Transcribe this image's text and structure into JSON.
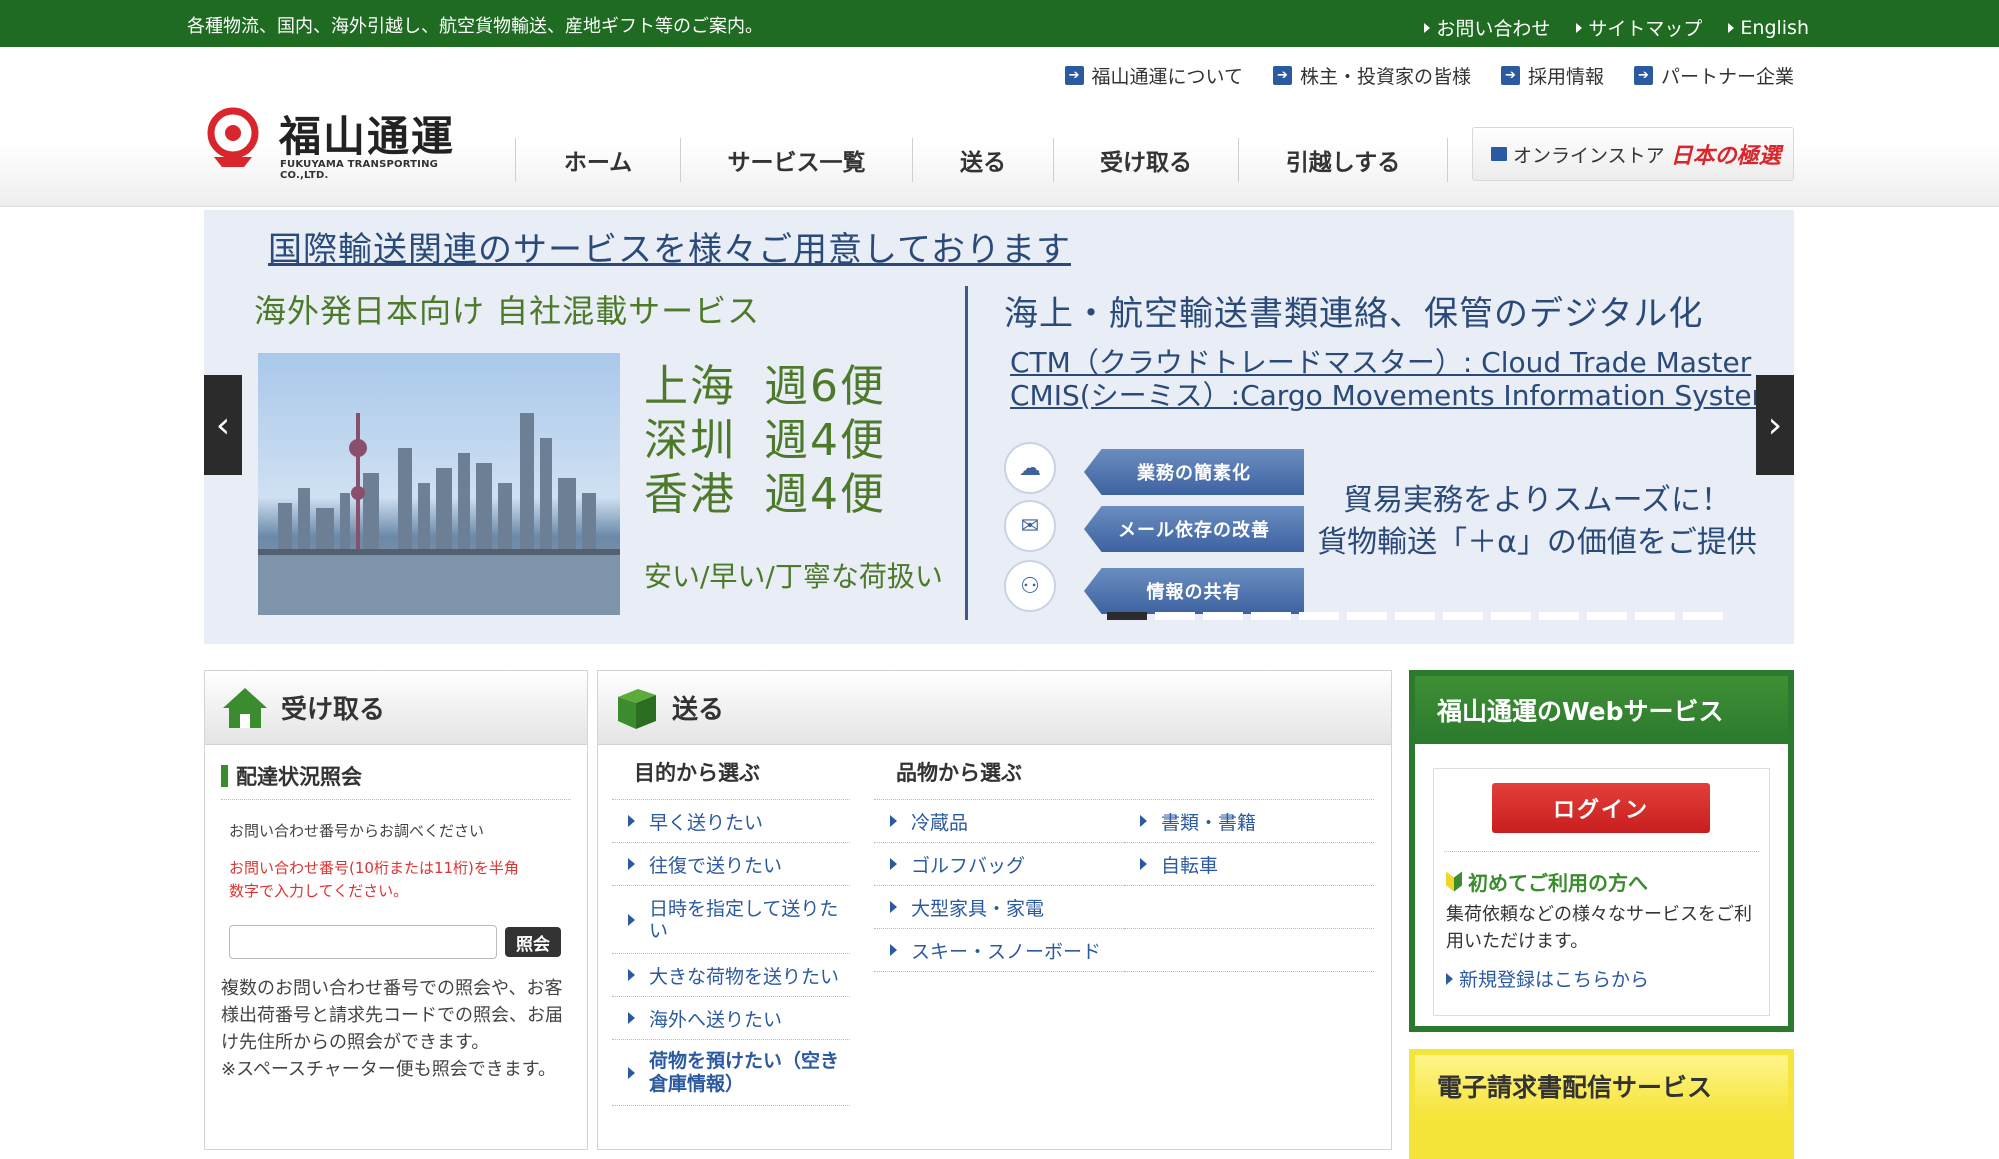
{
  "topbar": {
    "tagline": "各種物流、国内、海外引越し、航空貨物輸送、産地ギフト等のご案内。",
    "links": [
      "お問い合わせ",
      "サイトマップ",
      "English"
    ]
  },
  "subnav": [
    "福山通運について",
    "株主・投資家の皆様",
    "採用情報",
    "パートナー企業"
  ],
  "logo": {
    "name": "福山通運",
    "sub": "FUKUYAMA TRANSPORTING CO.,LTD."
  },
  "gnav": [
    "ホーム",
    "サービス一覧",
    "送る",
    "受け取る",
    "引越しする"
  ],
  "store": {
    "label": "オンラインストア",
    "brand": "日本の極選"
  },
  "banner": {
    "headline": "国際輸送関連のサービスを様々ご用意しております",
    "left_heading": "海外発日本向け 自社混載サービス",
    "routes": [
      {
        "city": "上海",
        "freq": "週6便"
      },
      {
        "city": "深圳",
        "freq": "週4便"
      },
      {
        "city": "香港",
        "freq": "週4便"
      }
    ],
    "slogan": "安い/早い/丁寧な荷扱い",
    "right_heading": "海上・航空輸送書類連絡、保管のデジタル化",
    "ctm": "CTM（クラウドトレードマスター）: Cloud Trade Master",
    "cmis": "CMIS(シーミス）:Cargo Movements Information System",
    "features": [
      "業務の簡素化",
      "メール依存の改善",
      "情報の共有"
    ],
    "right_slogan_1": "貿易実務をよりスムーズに！",
    "right_slogan_2": "貨物輸送「＋α」の価値をご提供",
    "slide_count": 13,
    "active_slide": 1
  },
  "receive": {
    "title": "受け取る",
    "section": "配達状況照会",
    "note": "お問い合わせ番号からお調べください",
    "warning_1": "お問い合わせ番号(10桁または11桁)を半角",
    "warning_2": "数字で入力してください。",
    "input_value": "",
    "button": "照会",
    "desc": "複数のお問い合わせ番号での照会や、お客様出荷番号と請求先コードでの照会、お届け先住所からの照会ができます。",
    "note2": "※スペースチャーター便も照会できます。"
  },
  "send": {
    "title": "送る",
    "purpose_head": "目的から選ぶ",
    "purpose": [
      "早く送りたい",
      "往復で送りたい",
      "日時を指定して送りたい",
      "大きな荷物を送りたい",
      "海外へ送りたい",
      "荷物を預けたい（空き倉庫情報）"
    ],
    "goods_head": "品物から選ぶ",
    "goods_col1": [
      "冷蔵品",
      "ゴルフバッグ",
      "大型家具・家電",
      "スキー・スノーボード"
    ],
    "goods_col2": [
      "書類・書籍",
      "自転車"
    ]
  },
  "webservice": {
    "title": "福山通運のWebサービス",
    "login": "ログイン",
    "first": "初めてご利用の方へ",
    "desc": "集荷依頼などの様々なサービスをご利用いただけます。",
    "register": "新規登録はこちらから"
  },
  "einvoice": {
    "title": "電子請求書配信サービス"
  },
  "colors": {
    "green": "#1e6b21",
    "blue": "#2c5aa0",
    "red": "#c81e1e",
    "yellow": "#f5e43a"
  }
}
